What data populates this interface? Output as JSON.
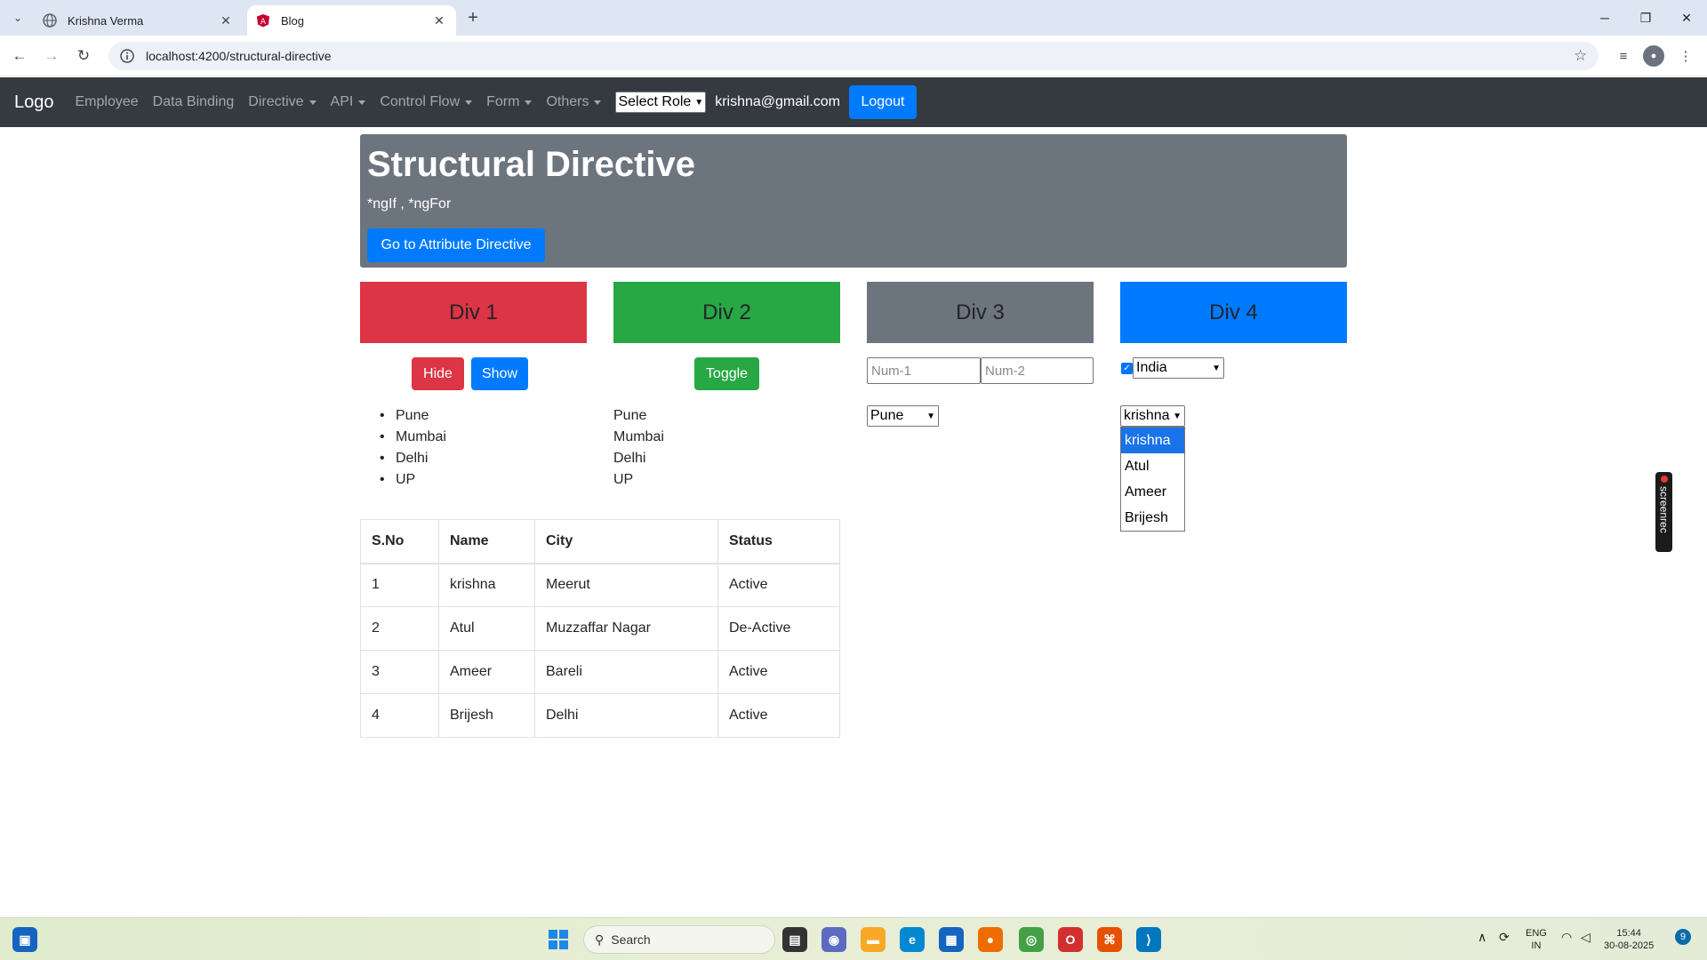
{
  "browser": {
    "tabs": [
      {
        "title": "Krishna Verma",
        "active": false
      },
      {
        "title": "Blog",
        "active": true
      }
    ],
    "url": "localhost:4200/structural-directive"
  },
  "navbar": {
    "brand": "Logo",
    "links": [
      "Employee",
      "Data Binding"
    ],
    "dropdowns": [
      "Directive",
      "API",
      "Control Flow",
      "Form",
      "Others"
    ],
    "role_select": "Select Role",
    "email": "krishna@gmail.com",
    "logout_label": "Logout"
  },
  "jumbotron": {
    "title": "Structural Directive",
    "subtitle": "*ngIf , *ngFor",
    "button_label": "Go to Attribute Directive"
  },
  "boxes": [
    {
      "label": "Div 1",
      "color": "#dc3545"
    },
    {
      "label": "Div 2",
      "color": "#28a745"
    },
    {
      "label": "Div 3",
      "color": "#6c757d"
    },
    {
      "label": "Div 4",
      "color": "#007bff"
    }
  ],
  "controls": {
    "hide_label": "Hide",
    "show_label": "Show",
    "toggle_label": "Toggle",
    "num1_placeholder": "Num-1",
    "num2_placeholder": "Num-2",
    "country_select": "India",
    "city_select": "Pune",
    "checkbox_checked": true,
    "name_select": "krishna",
    "name_options": [
      "krishna",
      "Atul",
      "Ameer",
      "Brijesh"
    ]
  },
  "cities": [
    "Pune",
    "Mumbai",
    "Delhi",
    "UP"
  ],
  "table": {
    "headers": [
      "S.No",
      "Name",
      "City",
      "Status"
    ],
    "rows": [
      [
        "1",
        "krishna",
        "Meerut",
        "Active"
      ],
      [
        "2",
        "Atul",
        "Muzzaffar Nagar",
        "De-Active"
      ],
      [
        "3",
        "Ameer",
        "Bareli",
        "Active"
      ],
      [
        "4",
        "Brijesh",
        "Delhi",
        "Active"
      ]
    ]
  },
  "screenrec_label": "screenrec",
  "taskbar": {
    "search_label": "Search",
    "lang_top": "ENG",
    "lang_bottom": "IN",
    "time": "15:44",
    "date": "30-08-2025",
    "notification_count": "9"
  }
}
